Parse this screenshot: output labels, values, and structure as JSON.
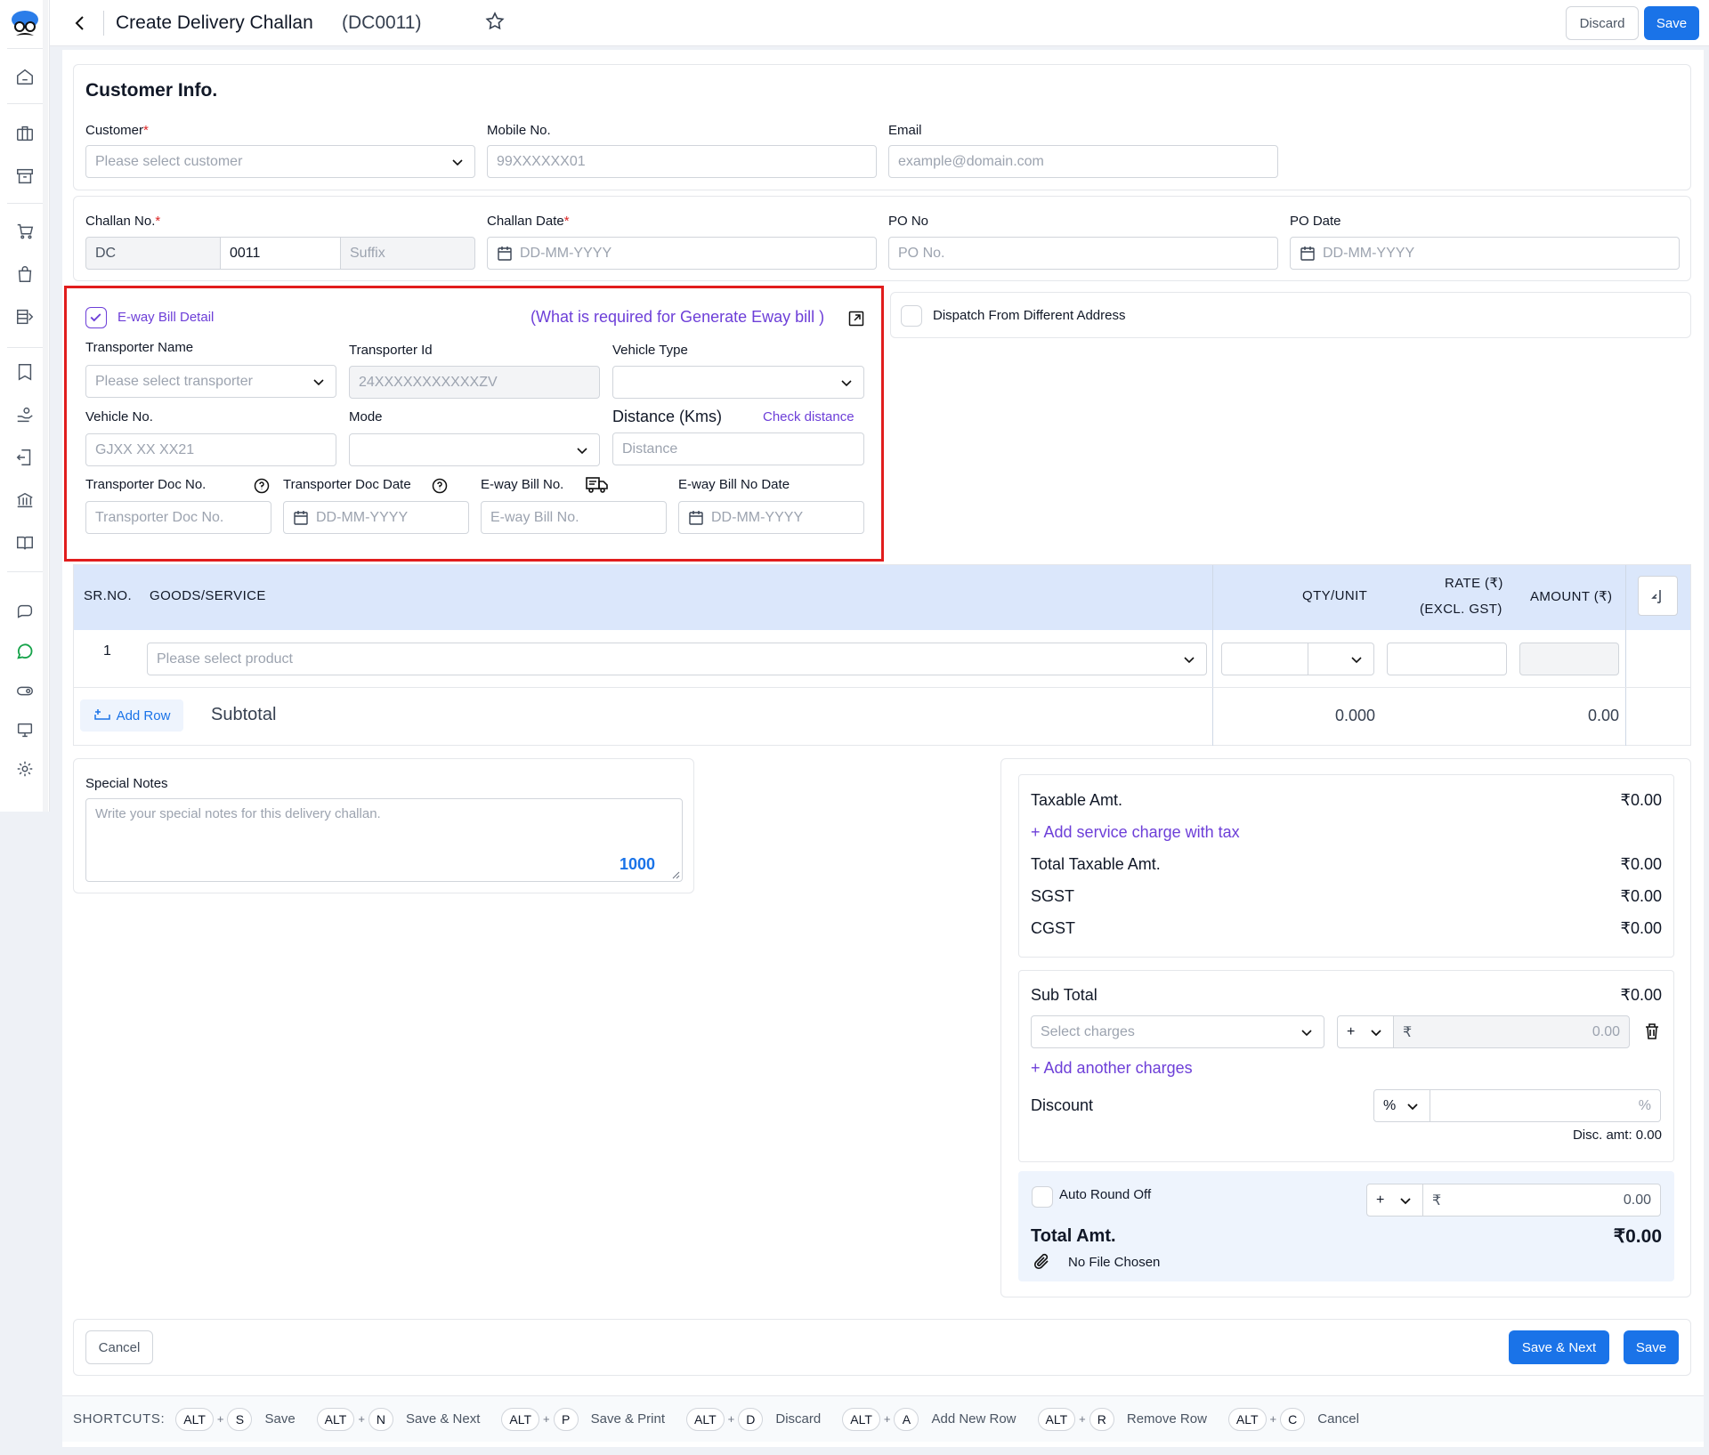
{
  "header": {
    "title": "Create Delivery Challan",
    "code": "(DC0011)",
    "discard_label": "Discard",
    "save_label": "Save"
  },
  "customer_info": {
    "section_title": "Customer Info.",
    "customer_label": "Customer",
    "customer_placeholder": "Please select customer",
    "mobile_label": "Mobile No.",
    "mobile_placeholder": "99XXXXXX01",
    "email_label": "Email",
    "email_placeholder": "example@domain.com"
  },
  "challan": {
    "challan_no_label": "Challan No.",
    "prefix": "DC",
    "number": "0011",
    "suffix_placeholder": "Suffix",
    "challan_date_label": "Challan Date",
    "date_placeholder": "DD-MM-YYYY",
    "po_no_label": "PO No",
    "po_no_placeholder": "PO No.",
    "po_date_label": "PO Date"
  },
  "eway": {
    "checkbox_label": "E-way Bill Detail",
    "checked": true,
    "help_link": "(What is required for Generate Eway bill )",
    "transporter_name_label": "Transporter Name",
    "transporter_name_placeholder": "Please select transporter",
    "transporter_id_label": "Transporter Id",
    "transporter_id_placeholder": "24XXXXXXXXXXXZV",
    "vehicle_type_label": "Vehicle Type",
    "vehicle_no_label": "Vehicle No.",
    "vehicle_no_placeholder": "GJXX XX XX21",
    "mode_label": "Mode",
    "distance_label": "Distance (Kms)",
    "check_distance": "Check distance",
    "distance_placeholder": "Distance",
    "doc_no_label": "Transporter Doc No.",
    "doc_no_placeholder": "Transporter Doc No.",
    "doc_date_label": "Transporter Doc Date",
    "bill_no_label": "E-way Bill No.",
    "bill_no_placeholder": "E-way Bill No.",
    "bill_date_label": "E-way Bill No Date",
    "date_placeholder": "DD-MM-YYYY"
  },
  "dispatch": {
    "label": "Dispatch From Different Address"
  },
  "items_table": {
    "col_sr": "SR.NO.",
    "col_goods": "GOODS/SERVICE",
    "col_qty": "QTY/UNIT",
    "col_rate_1": "RATE (₹)",
    "col_rate_2": "(EXCL. GST)",
    "col_amount": "AMOUNT (₹)",
    "rows": [
      {
        "sr": "1",
        "product_placeholder": "Please select product"
      }
    ],
    "add_row_label": "Add Row",
    "subtotal_label": "Subtotal",
    "subtotal_qty": "0.000",
    "subtotal_amount": "0.00"
  },
  "notes": {
    "label": "Special Notes",
    "placeholder": "Write your special notes for this delivery challan.",
    "char_limit": "1000"
  },
  "summary": {
    "taxable_label": "Taxable Amt.",
    "taxable_value": "₹0.00",
    "add_service_charge": "Add service charge with tax",
    "total_taxable_label": "Total Taxable Amt.",
    "total_taxable_value": "₹0.00",
    "sgst_label": "SGST",
    "sgst_value": "₹0.00",
    "cgst_label": "CGST",
    "cgst_value": "₹0.00",
    "sub_total_label": "Sub Total",
    "sub_total_value": "₹0.00",
    "charges_placeholder": "Select charges",
    "charges_sign": "+",
    "rupee": "₹",
    "charges_amount": "0.00",
    "add_another_charges": "Add another charges",
    "discount_label": "Discount",
    "discount_type": "%",
    "discount_suffix": "%",
    "disc_amt": "Disc. amt: 0.00",
    "auto_round_label": "Auto Round Off",
    "round_sign": "+",
    "round_amount": "0.00",
    "total_label": "Total Amt.",
    "total_value": "₹0.00",
    "file_label": "No File Chosen"
  },
  "footer": {
    "cancel_label": "Cancel",
    "save_next_label": "Save & Next",
    "save_label": "Save"
  },
  "shortcuts": {
    "title": "SHORTCUTS:",
    "items": [
      {
        "mod": "ALT",
        "key": "S",
        "label": "Save"
      },
      {
        "mod": "ALT",
        "key": "N",
        "label": "Save & Next"
      },
      {
        "mod": "ALT",
        "key": "P",
        "label": "Save & Print"
      },
      {
        "mod": "ALT",
        "key": "D",
        "label": "Discard"
      },
      {
        "mod": "ALT",
        "key": "A",
        "label": "Add New Row"
      },
      {
        "mod": "ALT",
        "key": "R",
        "label": "Remove Row"
      },
      {
        "mod": "ALT",
        "key": "C",
        "label": "Cancel"
      }
    ]
  },
  "colors": {
    "primary": "#1a73e8",
    "link": "#6d3fd8",
    "highlight_border": "#e11d1d",
    "table_header_bg": "#dbe7fb",
    "whatsapp": "#16a34a"
  }
}
